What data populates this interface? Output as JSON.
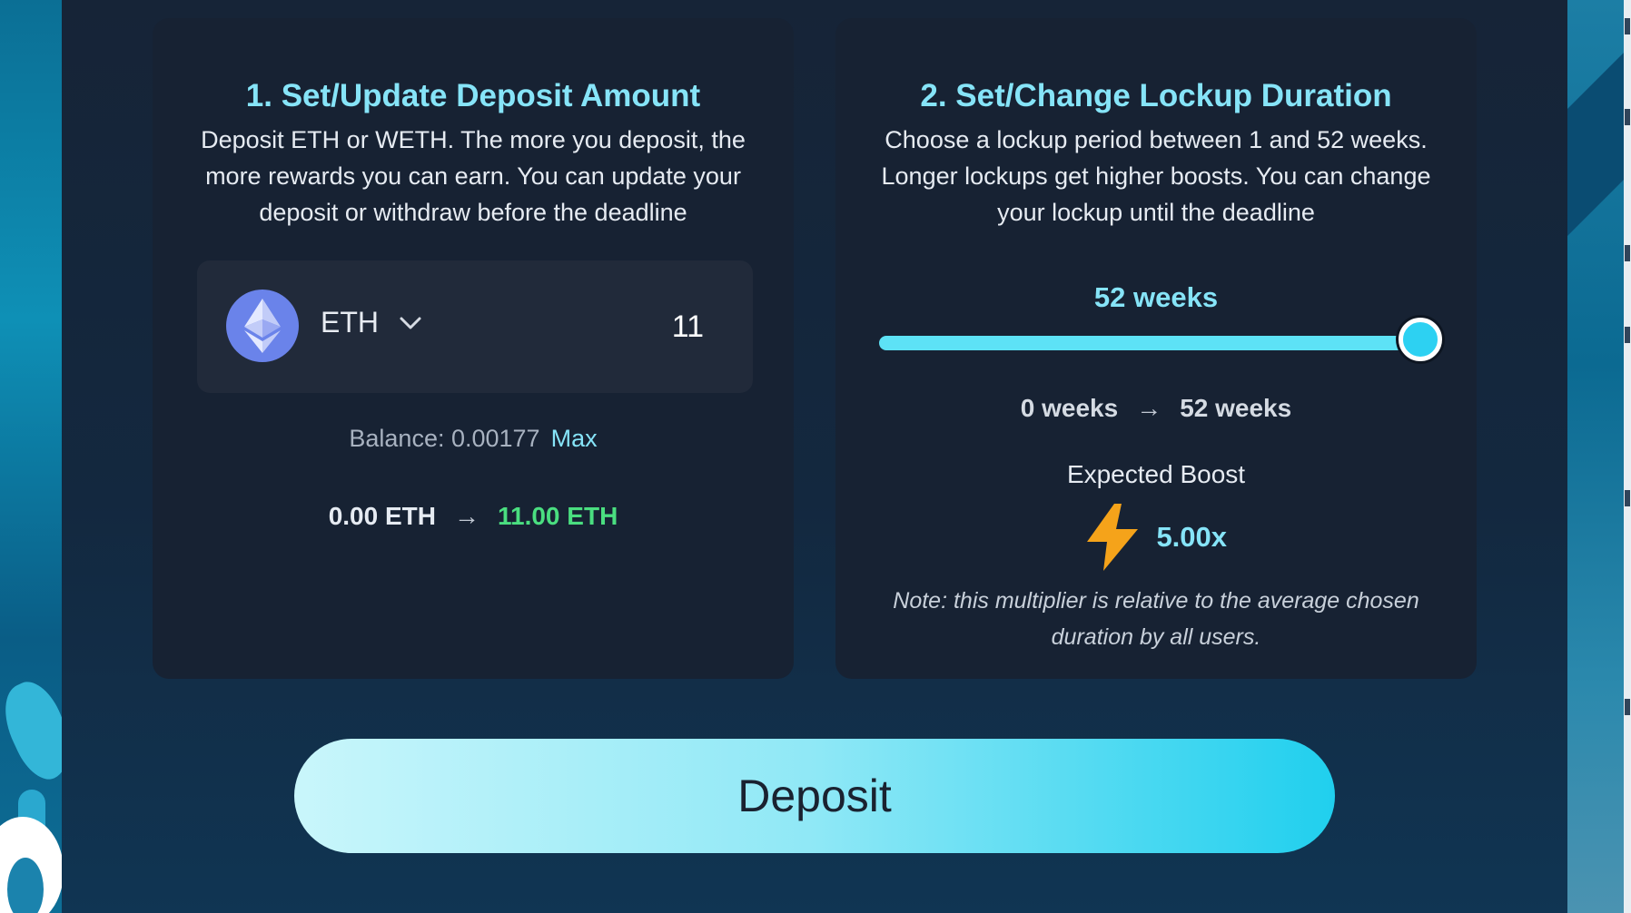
{
  "deposit_card": {
    "title": "1. Set/Update Deposit Amount",
    "description": "Deposit ETH or WETH. The more you deposit, the more rewards you can earn. You can update your deposit or withdraw before the deadline",
    "token": {
      "name": "ETH",
      "icon": "ethereum-icon"
    },
    "amount": "11",
    "balance_label": "Balance: 0.00177",
    "max_label": "Max",
    "current_amount": "0.00 ETH",
    "new_amount": "11.00 ETH"
  },
  "lockup_card": {
    "title": "2. Set/Change Lockup Duration",
    "description": "Choose a lockup period between 1 and 52 weeks. Longer lockups get higher boosts. You can change your lockup until the deadline",
    "selected_weeks_label": "52 weeks",
    "slider": {
      "min": 1,
      "max": 52,
      "value": 52
    },
    "current_weeks": "0 weeks",
    "new_weeks": "52 weeks",
    "boost_label": "Expected Boost",
    "boost_value": "5.00x",
    "note": "Note: this multiplier is relative to the average chosen duration by all users."
  },
  "deposit_button_label": "Deposit",
  "colors": {
    "accent": "#86e4f8",
    "positive": "#4ade80",
    "bolt": "#f5a31a",
    "eth": "#6a83ea"
  }
}
